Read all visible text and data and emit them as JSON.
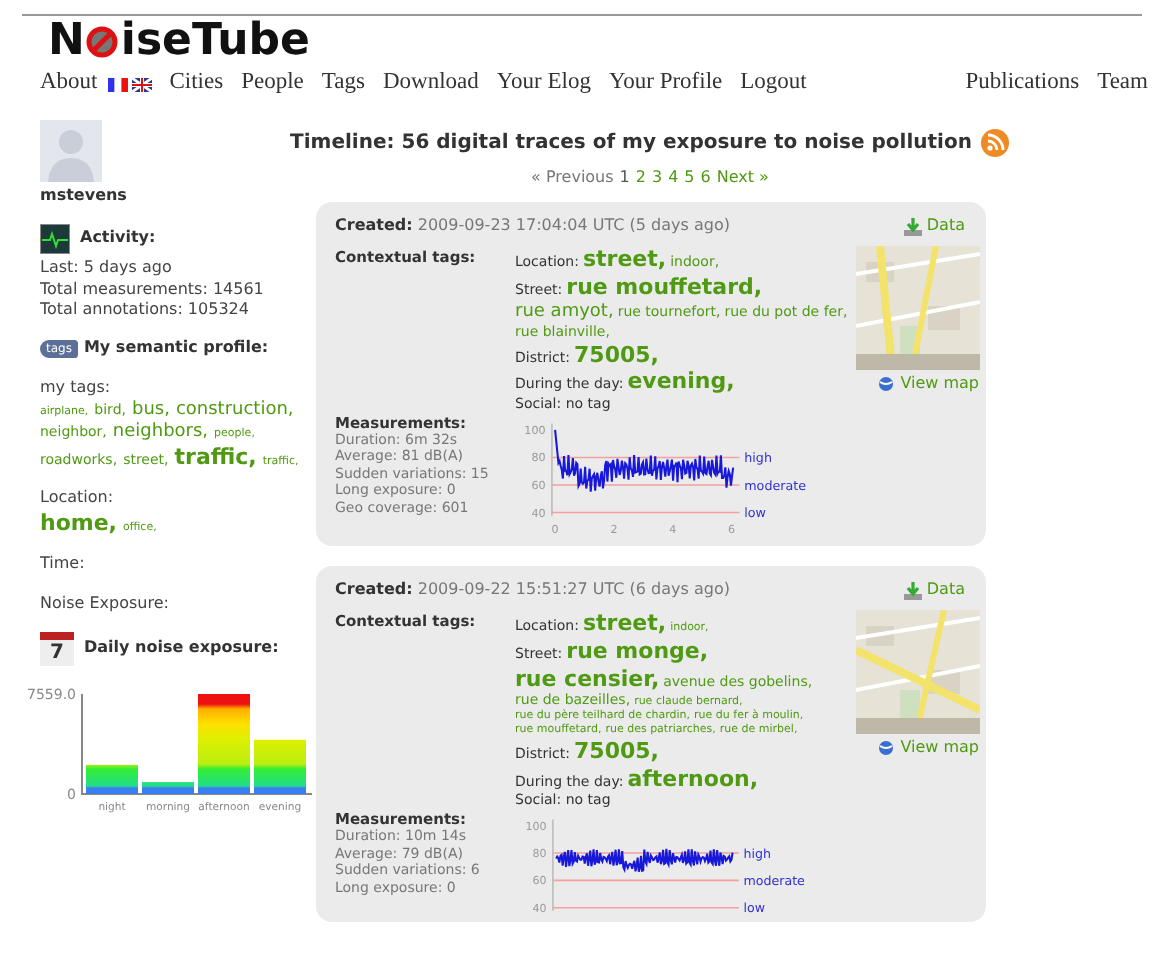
{
  "logo": {
    "before": "N",
    "after": "iseTube"
  },
  "nav": {
    "left": [
      "About",
      "Cities",
      "People",
      "Tags",
      "Download",
      "Your Elog",
      "Your Profile",
      "Logout"
    ],
    "right": [
      "Publications",
      "Team"
    ]
  },
  "sidebar": {
    "username": "mstevens",
    "activity": {
      "heading": "Activity:",
      "lines": [
        "Last: 5 days ago",
        "Total measurements: 14561",
        "Total annotations: 105324"
      ]
    },
    "semantic": {
      "icon_label": "tags",
      "heading": "My semantic profile:",
      "my_tags_label": "my tags:",
      "tags": [
        {
          "label": "airplane,",
          "kind": "tiny"
        },
        {
          "label": "bird,",
          "kind": "small"
        },
        {
          "label": "bus,",
          "kind": "medium"
        },
        {
          "label": "construction,",
          "kind": "medium"
        },
        {
          "label": "neighbor,",
          "kind": "small"
        },
        {
          "label": "neighbors,",
          "kind": "medium"
        },
        {
          "label": "people,",
          "kind": "tiny"
        },
        {
          "label": "roadworks,",
          "kind": "small"
        },
        {
          "label": "street,",
          "kind": "small"
        },
        {
          "label": "traffic,",
          "kind": "large"
        },
        {
          "label": "traffic,",
          "kind": "tiny"
        }
      ],
      "location_label": "Location:",
      "location_tags": [
        {
          "label": "home,",
          "kind": "large"
        },
        {
          "label": "office,",
          "kind": "tiny"
        }
      ],
      "time_label": "Time:",
      "noise_label": "Noise Exposure:"
    },
    "daily": {
      "calendar_day": "7",
      "heading": "Daily noise exposure:",
      "chart_data": {
        "type": "bar",
        "categories": [
          "night",
          "morning",
          "afternoon",
          "evening"
        ],
        "values": [
          2200,
          900,
          7559,
          4100
        ],
        "ylim": [
          0,
          7559
        ],
        "yticks": [
          0,
          {
            "value": 7559,
            "label": "7559.0"
          }
        ]
      }
    }
  },
  "main": {
    "title": "Timeline: 56 digital traces of my exposure to noise pollution",
    "pagination": {
      "previous": {
        "label": "« Previous",
        "disabled": true
      },
      "pages": [
        {
          "label": "1",
          "selected": true
        },
        {
          "label": "2",
          "selected": false
        },
        {
          "label": "3",
          "selected": false
        },
        {
          "label": "4",
          "selected": false
        },
        {
          "label": "5",
          "selected": false
        },
        {
          "label": "6",
          "selected": false
        }
      ],
      "next": {
        "label": "Next »",
        "disabled": false
      }
    },
    "traces": [
      {
        "created_label": "Created:",
        "created": "2009-09-23 17:04:04 UTC (5 days ago)",
        "data_link": "Data",
        "tags_label": "Contextual tags:",
        "rows": [
          {
            "label": "Location:",
            "tags": [
              {
                "label": "street,",
                "kind": "large"
              },
              {
                "label": "indoor,",
                "kind": "small"
              }
            ]
          },
          {
            "label": "Street:",
            "tags": [
              {
                "label": "rue mouffetard,",
                "kind": "large"
              },
              {
                "label": "rue amyot,",
                "kind": "medium"
              },
              {
                "label": "rue tournefort,",
                "kind": "small"
              },
              {
                "label": "rue du pot de fer,",
                "kind": "small"
              },
              {
                "label": "rue blainville,",
                "kind": "small"
              }
            ]
          },
          {
            "label": "District:",
            "tags": [
              {
                "label": "75005,",
                "kind": "large"
              }
            ]
          },
          {
            "label": "During the day:",
            "tags": [
              {
                "label": "evening,",
                "kind": "large"
              }
            ]
          },
          {
            "label": "Social: no tag",
            "tags": []
          }
        ],
        "map_link": "View map",
        "measurements_label": "Measurements:",
        "measurements": [
          "Duration: 6m 32s",
          "Average: 81 dB(A)",
          "Sudden variations: 15",
          "Long exposure: 0",
          "Geo coverage: 601"
        ],
        "chart": {
          "yticks": [
            "100",
            "80",
            "60",
            "40"
          ],
          "xticks": [
            "0",
            "2",
            "4",
            "6"
          ],
          "levels": [
            "high",
            "moderate",
            "low"
          ]
        }
      },
      {
        "created_label": "Created:",
        "created": "2009-09-22 15:51:27 UTC (6 days ago)",
        "data_link": "Data",
        "tags_label": "Contextual tags:",
        "rows": [
          {
            "label": "Location:",
            "tags": [
              {
                "label": "street,",
                "kind": "large"
              },
              {
                "label": "indoor,",
                "kind": "tiny"
              }
            ]
          },
          {
            "label": "Street:",
            "tags": [
              {
                "label": "rue monge,",
                "kind": "large"
              },
              {
                "label": "rue censier,",
                "kind": "large"
              },
              {
                "label": "avenue des gobelins,",
                "kind": "small"
              },
              {
                "label": "rue de bazeilles,",
                "kind": "small"
              },
              {
                "label": "rue claude bernard,",
                "kind": "tiny"
              },
              {
                "label": "rue du père teilhard de chardin,",
                "kind": "tiny"
              },
              {
                "label": "rue du fer à moulin,",
                "kind": "tiny"
              },
              {
                "label": "rue mouffetard,",
                "kind": "tiny"
              },
              {
                "label": "rue des patriarches,",
                "kind": "tiny"
              },
              {
                "label": "rue de mirbel,",
                "kind": "tiny"
              }
            ]
          },
          {
            "label": "District:",
            "tags": [
              {
                "label": "75005,",
                "kind": "large"
              }
            ]
          },
          {
            "label": "During the day:",
            "tags": [
              {
                "label": "afternoon,",
                "kind": "large"
              }
            ]
          },
          {
            "label": "Social: no tag",
            "tags": []
          }
        ],
        "map_link": "View map",
        "measurements_label": "Measurements:",
        "measurements": [
          "Duration: 10m 14s",
          "Average: 79 dB(A)",
          "Sudden variations: 6",
          "Long exposure: 0"
        ],
        "chart": {
          "yticks": [
            "100",
            "80",
            "60",
            "40"
          ],
          "levels": [
            "high",
            "moderate",
            "low"
          ]
        }
      }
    ]
  }
}
